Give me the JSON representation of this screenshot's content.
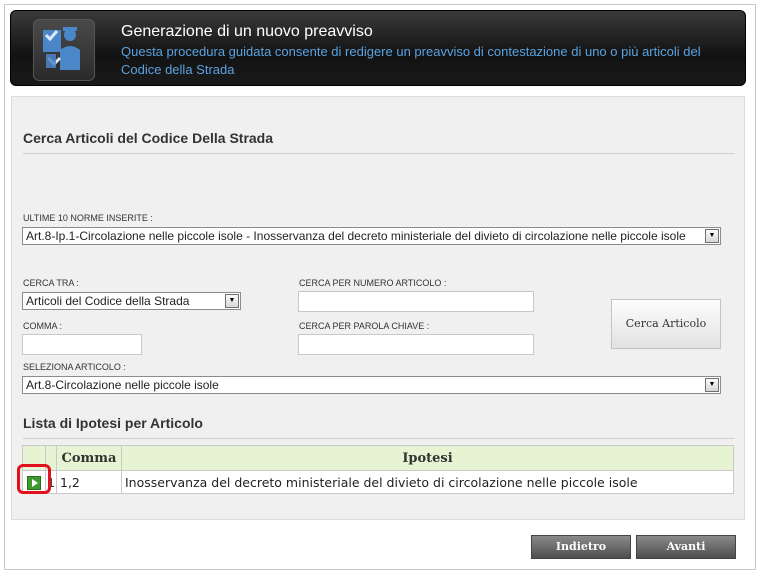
{
  "header": {
    "title": "Generazione di un nuovo preavviso",
    "subtitle": "Questa procedura guidata consente di redigere un preavviso di contestazione di uno o più articoli del Codice della Strada",
    "icon": "officer-document-icon"
  },
  "search": {
    "section_title": "Cerca Articoli del Codice Della Strada",
    "last_norms_label": "ULTIME 10 NORME INSERITE :",
    "last_norms_value": "Art.8-Ip.1-Circolazione nelle piccole isole - Inosservanza del decreto ministeriale del divieto di circolazione nelle piccole isole",
    "search_in_label": "CERCA TRA :",
    "search_in_value": "Articoli del Codice della Strada",
    "article_number_label": "CERCA PER NUMERO ARTICOLO :",
    "article_number_value": "",
    "comma_label": "COMMA :",
    "comma_value": "",
    "keyword_label": "CERCA PER PAROLA CHIAVE :",
    "keyword_value": "",
    "search_button": "Cerca Articolo",
    "select_article_label": "SELEZIONA ARTICOLO :",
    "select_article_value": "Art.8-Circolazione nelle piccole isole"
  },
  "hypotheses": {
    "section_title": "Lista di Ipotesi per Articolo",
    "columns": [
      "Comma",
      "Ipotesi"
    ],
    "rows": [
      {
        "index": "1",
        "comma": "1,2",
        "ipotesi": "Inosservanza del decreto ministeriale del divieto di circolazione nelle piccole isole"
      }
    ]
  },
  "nav": {
    "back": "Indietro",
    "next": "Avanti"
  },
  "colors": {
    "header_bg": "#1a1a1a",
    "subtitle": "#5aa2e0",
    "table_header": "#e6f4d4",
    "highlight": "#e0121d"
  }
}
